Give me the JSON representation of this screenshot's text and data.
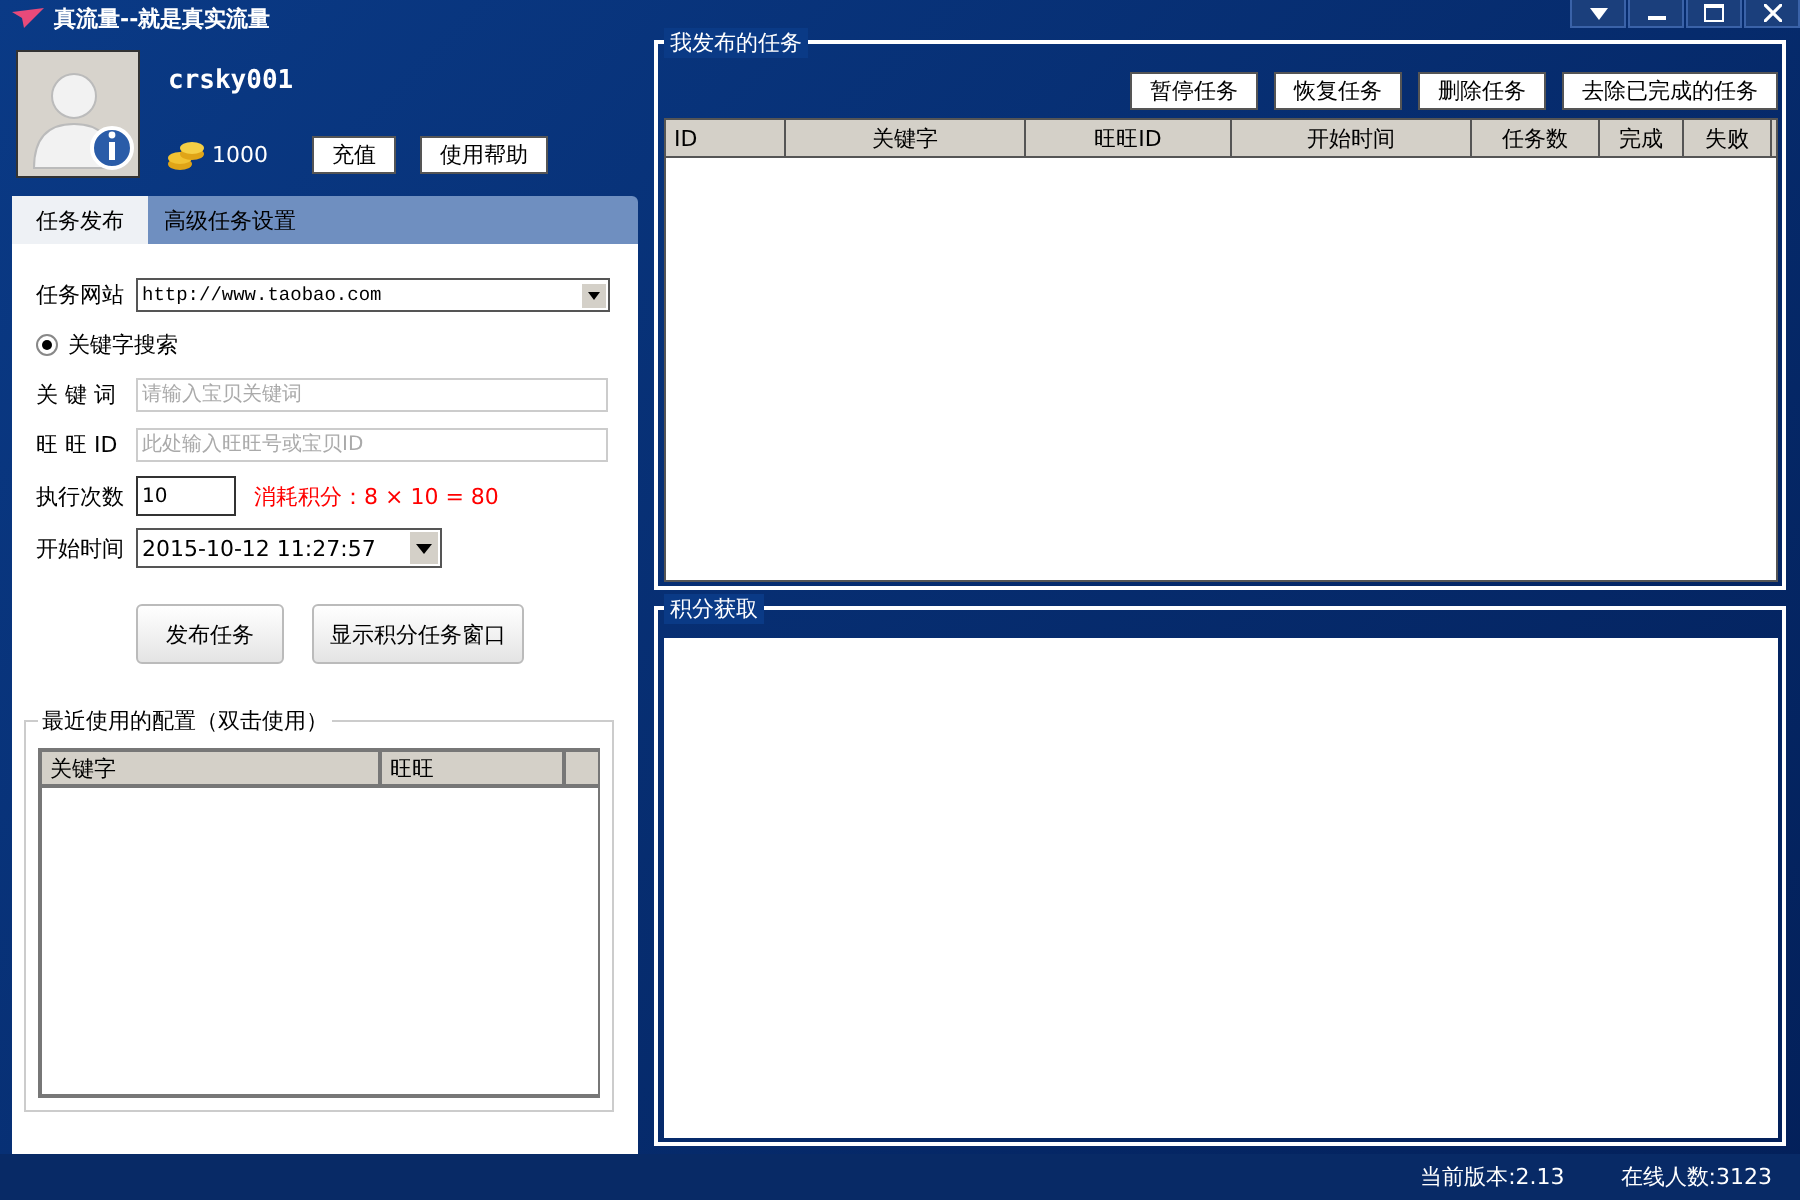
{
  "window": {
    "title": "真流量--就是真实流量"
  },
  "user": {
    "name": "crsky001",
    "points": "1000",
    "buttons": [
      "充值",
      "使用帮助"
    ]
  },
  "tabs": [
    {
      "label": "任务发布",
      "selected": true
    },
    {
      "label": "高级任务设置",
      "selected": false
    }
  ],
  "form": {
    "website": {
      "label": "任务网站",
      "value": "http://www.taobao.com"
    },
    "search_mode": {
      "label": "关键字搜索",
      "selected": true
    },
    "keyword": {
      "label": "关 键 词",
      "placeholder": "请输入宝贝关键词"
    },
    "wangwang": {
      "label": "旺 旺 ID",
      "placeholder": "此处输入旺旺号或宝贝ID"
    },
    "count": {
      "label": "执行次数",
      "value": "10",
      "cost": "消耗积分：8 × 10 = 80"
    },
    "start_time": {
      "label": "开始时间",
      "value": "2015-10-12 11:27:57"
    },
    "buttons": [
      "发布任务",
      "显示积分任务窗口"
    ]
  },
  "recent": {
    "title": "最近使用的配置（双击使用）",
    "columns": [
      "关键字",
      "旺旺"
    ]
  },
  "tasks": {
    "title": "我发布的任务",
    "buttons": [
      "暂停任务",
      "恢复任务",
      "删除任务",
      "去除已完成的任务"
    ],
    "columns": [
      "ID",
      "关键字",
      "旺旺ID",
      "开始时间",
      "任务数",
      "完成",
      "失败"
    ]
  },
  "points_panel": {
    "title": "积分获取"
  },
  "status_bar": {
    "version": "当前版本:2.13",
    "online": "在线人数:3123"
  }
}
